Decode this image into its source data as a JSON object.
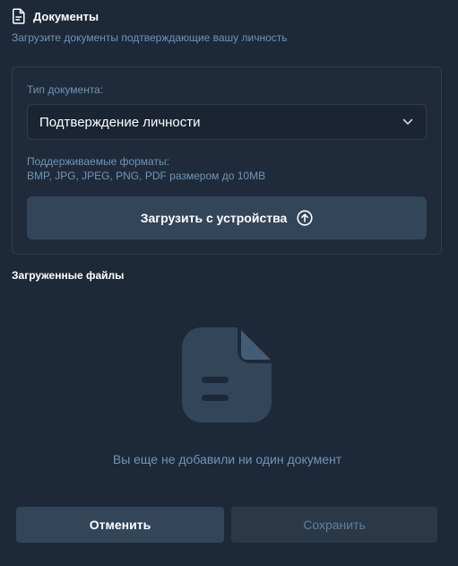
{
  "header": {
    "title": "Документы",
    "subtitle": "Загрузите документы подтверждающие вашу личность",
    "icon": "document-icon"
  },
  "upload_card": {
    "doc_type_label": "Тип документа:",
    "doc_type_value": "Подтверждение личности",
    "formats_label": "Поддерживаемые форматы:",
    "formats_value": "BMP, JPG, JPEG, PNG, PDF размером до 10MB",
    "upload_button_label": "Загрузить с устройства",
    "upload_icon": "upload-circle-icon"
  },
  "uploaded_files": {
    "title": "Загруженные файлы",
    "empty_message": "Вы еще не добавили ни один документ",
    "empty_icon": "empty-document-icon"
  },
  "actions": {
    "cancel_label": "Отменить",
    "save_label": "Сохранить"
  },
  "colors": {
    "background": "#1d2938",
    "card_border": "#2e3d50",
    "accent_text": "#6f95b8",
    "button": "#334559",
    "button_disabled": "#2a3848"
  }
}
